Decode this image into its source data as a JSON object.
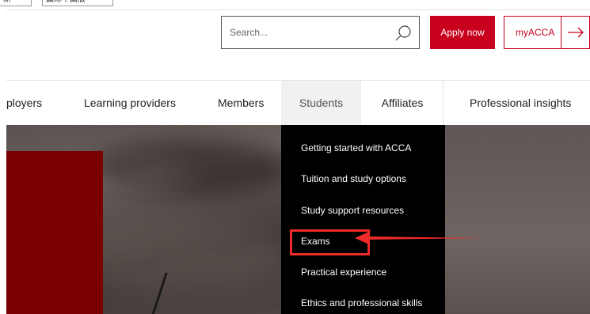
{
  "top_bar": {
    "fragment_1": "新",
    "fragment_2": "国际中国版"
  },
  "header": {
    "search": {
      "placeholder": "Search...",
      "value": ""
    },
    "apply_label": "Apply now",
    "myacca_label": "myACCA",
    "brand_color": "#c8001e"
  },
  "nav": {
    "items": [
      {
        "label": "ployers"
      },
      {
        "label": "Learning providers"
      },
      {
        "label": "Members"
      },
      {
        "label": "Students"
      },
      {
        "label": "Affiliates"
      },
      {
        "label": "Professional insights"
      }
    ],
    "active": "Students"
  },
  "dropdown": {
    "items": [
      {
        "label": "Getting started with ACCA"
      },
      {
        "label": "Tuition and study options"
      },
      {
        "label": "Study support resources"
      },
      {
        "label": "Exams"
      },
      {
        "label": "Practical experience"
      },
      {
        "label": "Ethics and professional skills"
      }
    ]
  },
  "annotation": {
    "highlighted_item": "Exams",
    "color": "#ee2a2a",
    "icon": "pointer-arrow-icon"
  }
}
